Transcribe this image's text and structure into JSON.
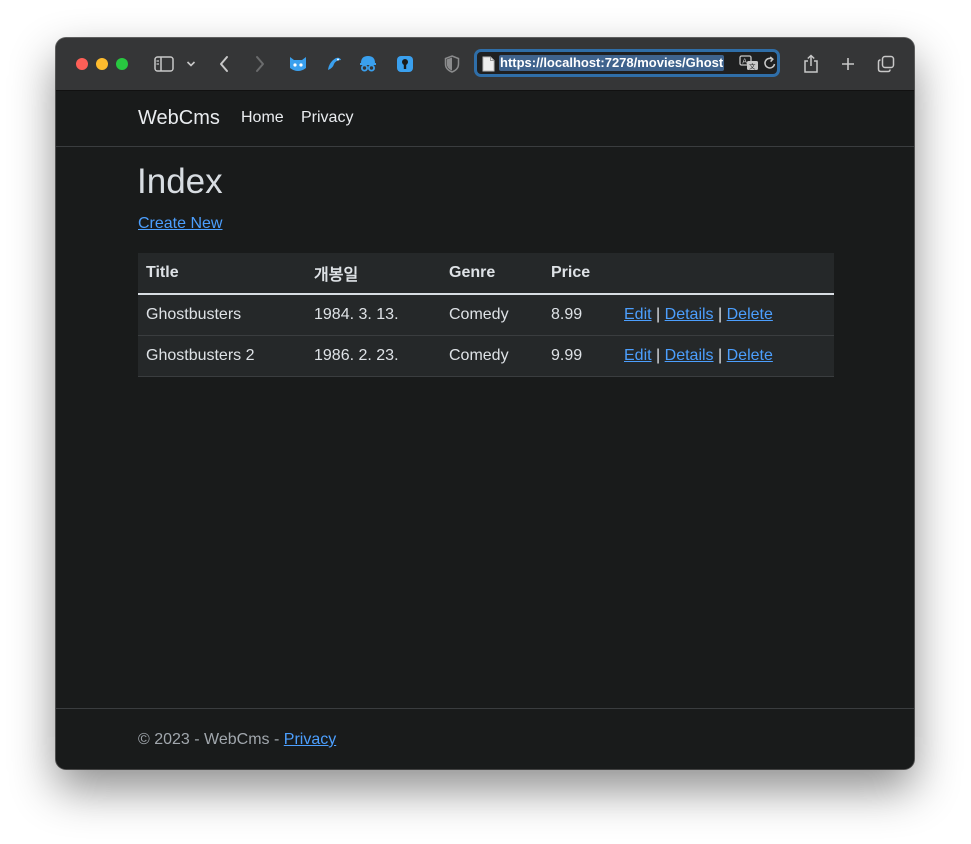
{
  "browser": {
    "url": "https://localhost:7278/movies/Ghost",
    "icons": [
      "sidebar-icon",
      "chevron-down-icon",
      "back-icon",
      "forward-icon",
      "extension-icon",
      "extension-icon",
      "extension-icon",
      "extension-icon",
      "privacy-shield-icon",
      "translate-icon",
      "reload-icon",
      "share-icon",
      "new-tab-icon",
      "tabs-overview-icon"
    ],
    "accent_color": "#2f6ea8"
  },
  "navbar": {
    "brand": "WebCms",
    "links": [
      "Home",
      "Privacy"
    ]
  },
  "main": {
    "title": "Index",
    "create_link": "Create New",
    "table": {
      "headers": [
        "Title",
        "개봉일",
        "Genre",
        "Price",
        ""
      ],
      "rows": [
        {
          "title": "Ghostbusters",
          "release": "1984. 3. 13.",
          "genre": "Comedy",
          "price": "8.99"
        },
        {
          "title": "Ghostbusters 2",
          "release": "1986. 2. 23.",
          "genre": "Comedy",
          "price": "9.99"
        }
      ],
      "actions": {
        "edit": "Edit",
        "details": "Details",
        "delete": "Delete",
        "separator": "|"
      }
    }
  },
  "footer": {
    "text": "© 2023 - WebCms - ",
    "link": "Privacy"
  },
  "colors": {
    "page_background": "#191b1b",
    "link": "#4c9ffe",
    "table_background": "#252829"
  }
}
